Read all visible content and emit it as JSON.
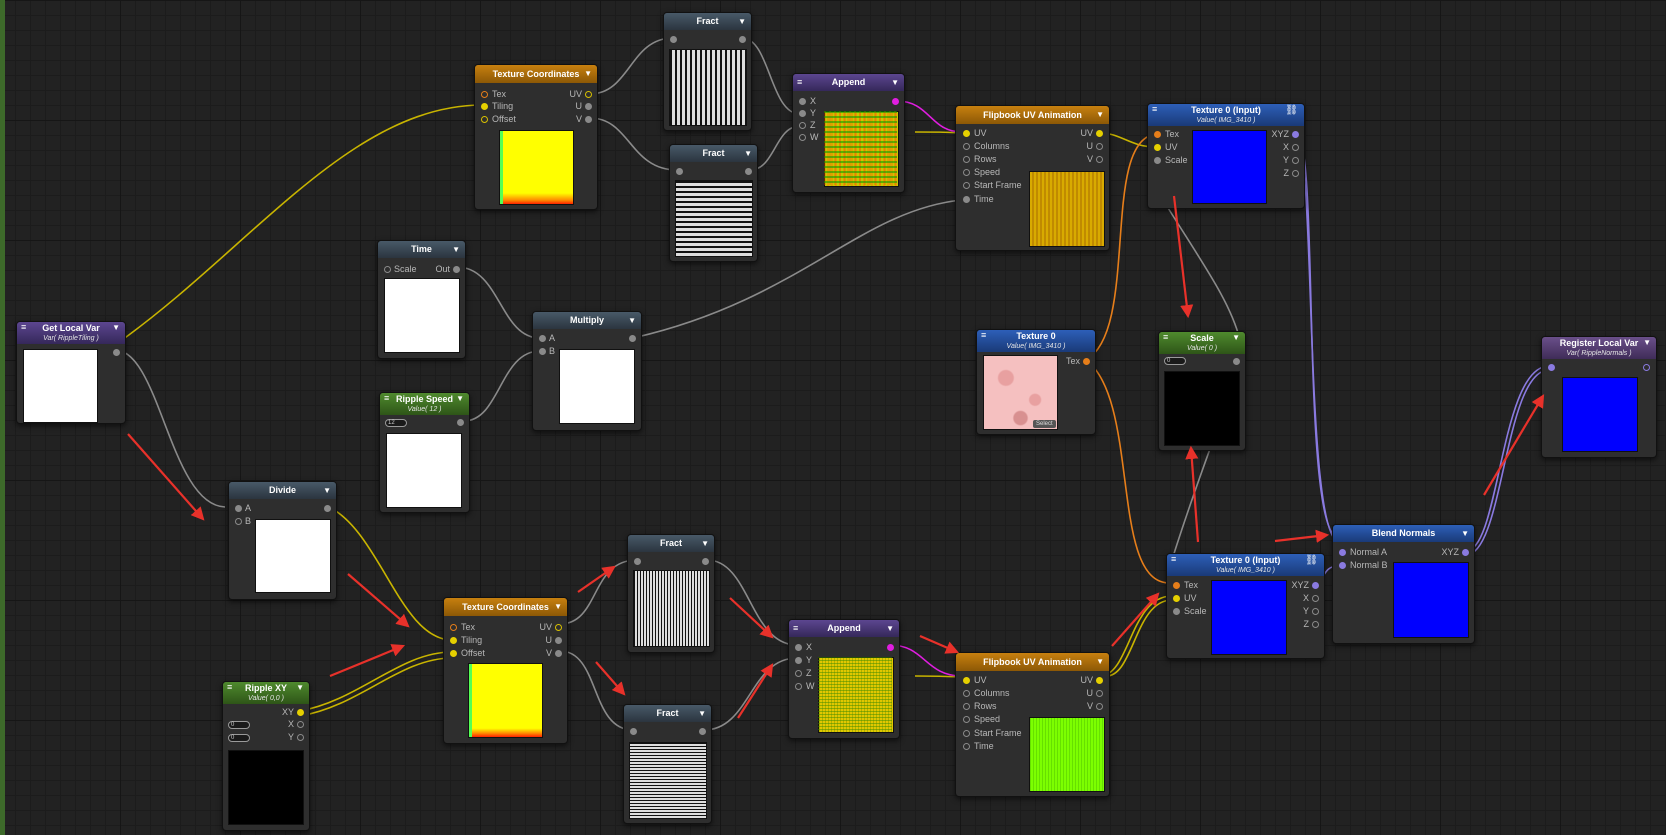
{
  "nodes": {
    "get_local_var": {
      "title": "Get Local Var",
      "sub": "Var( RippleTiling )"
    },
    "tc_top": {
      "title": "Texture Coordinates",
      "in": [
        "Tex",
        "Tiling",
        "Offset"
      ],
      "out": [
        "UV",
        "U",
        "V"
      ]
    },
    "fract_a": {
      "title": "Fract"
    },
    "fract_b": {
      "title": "Fract"
    },
    "append_top": {
      "title": "Append",
      "in": [
        "X",
        "Y",
        "Z",
        "W"
      ]
    },
    "flip_top": {
      "title": "Flipbook UV Animation",
      "in": [
        "UV",
        "Columns",
        "Rows",
        "Speed",
        "Start Frame",
        "Time"
      ],
      "out": [
        "UV",
        "U",
        "V"
      ]
    },
    "tex0_input_top": {
      "title": "Texture 0 (Input)",
      "sub": "Value( IMG_3410 )",
      "in": [
        "Tex",
        "UV",
        "Scale"
      ],
      "out": [
        "XYZ",
        "X",
        "Y",
        "Z"
      ]
    },
    "time": {
      "title": "Time",
      "in": [
        "Scale"
      ],
      "out": [
        "Out"
      ]
    },
    "multiply": {
      "title": "Multiply",
      "in": [
        "A",
        "B"
      ]
    },
    "ripple_speed": {
      "title": "Ripple Speed",
      "sub": "Value( 12 )",
      "value": "12"
    },
    "texture0": {
      "title": "Texture 0",
      "sub": "Value( IMG_3410 )",
      "out": [
        "Tex"
      ],
      "select": "Select"
    },
    "scale": {
      "title": "Scale",
      "sub": "Value( 0 )",
      "value": "0"
    },
    "register_local_var": {
      "title": "Register Local Var",
      "sub": "Var( RippleNormals )"
    },
    "divide": {
      "title": "Divide",
      "in": [
        "A",
        "B"
      ]
    },
    "tc_bottom": {
      "title": "Texture Coordinates",
      "in": [
        "Tex",
        "Tiling",
        "Offset"
      ],
      "out": [
        "UV",
        "U",
        "V"
      ]
    },
    "fract_c": {
      "title": "Fract"
    },
    "fract_d": {
      "title": "Fract"
    },
    "append_bottom": {
      "title": "Append",
      "in": [
        "X",
        "Y",
        "Z",
        "W"
      ]
    },
    "flip_bottom": {
      "title": "Flipbook UV Animation",
      "in": [
        "UV",
        "Columns",
        "Rows",
        "Speed",
        "Start Frame",
        "Time"
      ],
      "out": [
        "UV",
        "U",
        "V"
      ]
    },
    "tex0_input_bottom": {
      "title": "Texture 0 (Input)",
      "sub": "Value( IMG_3410 )",
      "in": [
        "Tex",
        "UV",
        "Scale"
      ],
      "out": [
        "XYZ",
        "X",
        "Y",
        "Z"
      ]
    },
    "blend_normals": {
      "title": "Blend Normals",
      "in": [
        "Normal A",
        "Normal B"
      ],
      "out": [
        "XYZ"
      ]
    },
    "ripple_xy": {
      "title": "Ripple XY",
      "sub": "Value( 0,0 )",
      "out": [
        "XY",
        "X",
        "Y"
      ],
      "values": [
        "0",
        "0"
      ]
    }
  },
  "colors": {
    "canvas": "#222222",
    "wire_float": "#8a8a8a",
    "wire_vec2": "#d8c000",
    "wire_vec4": "#e01ee0",
    "wire_tex": "#e67e1a",
    "wire_vec3": "#8a7ae0",
    "annotation_arrow": "#e8312a"
  }
}
